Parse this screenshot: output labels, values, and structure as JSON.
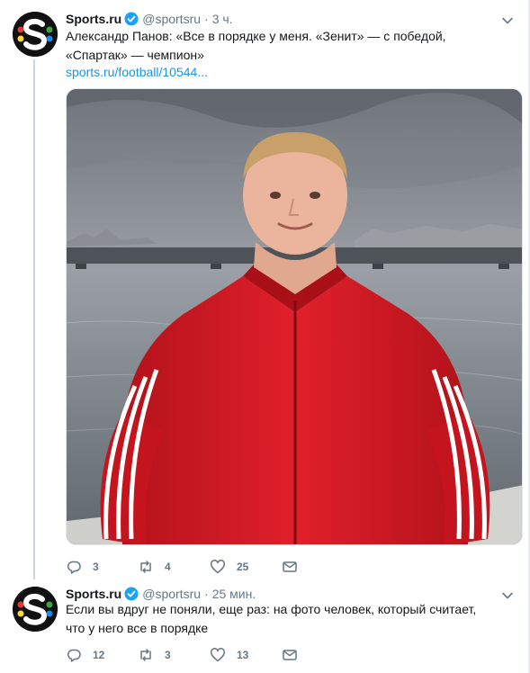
{
  "tweets": [
    {
      "author_name": "Sports.ru",
      "author_handle": "@sportsru",
      "time_sep": "·",
      "time": "3 ч.",
      "text": "Александр Панов: «Все в порядке у меня. «Зенит» — с победой, «Спартак» — чемпион»",
      "link": "sports.ru/football/10544...",
      "media_icon": "photo-man-red-tracksuit-embankment",
      "replies": "3",
      "retweets": "4",
      "likes": "25"
    },
    {
      "author_name": "Sports.ru",
      "author_handle": "@sportsru",
      "time_sep": "·",
      "time": "25 мин.",
      "text": "Если вы вдруг не поняли, еще раз: на фото человек, который считает, что у него все в порядке",
      "replies": "12",
      "retweets": "3",
      "likes": "13"
    }
  ],
  "colors": {
    "verified": "#1da1f2",
    "link": "#1b95e0",
    "muted": "#657786",
    "thread_line": "#ccd6dd"
  },
  "icons": {
    "reply": "reply-icon",
    "retweet": "retweet-icon",
    "like": "heart-icon",
    "message": "envelope-icon",
    "verified": "verified-badge-icon",
    "caret": "chevron-down-icon"
  }
}
